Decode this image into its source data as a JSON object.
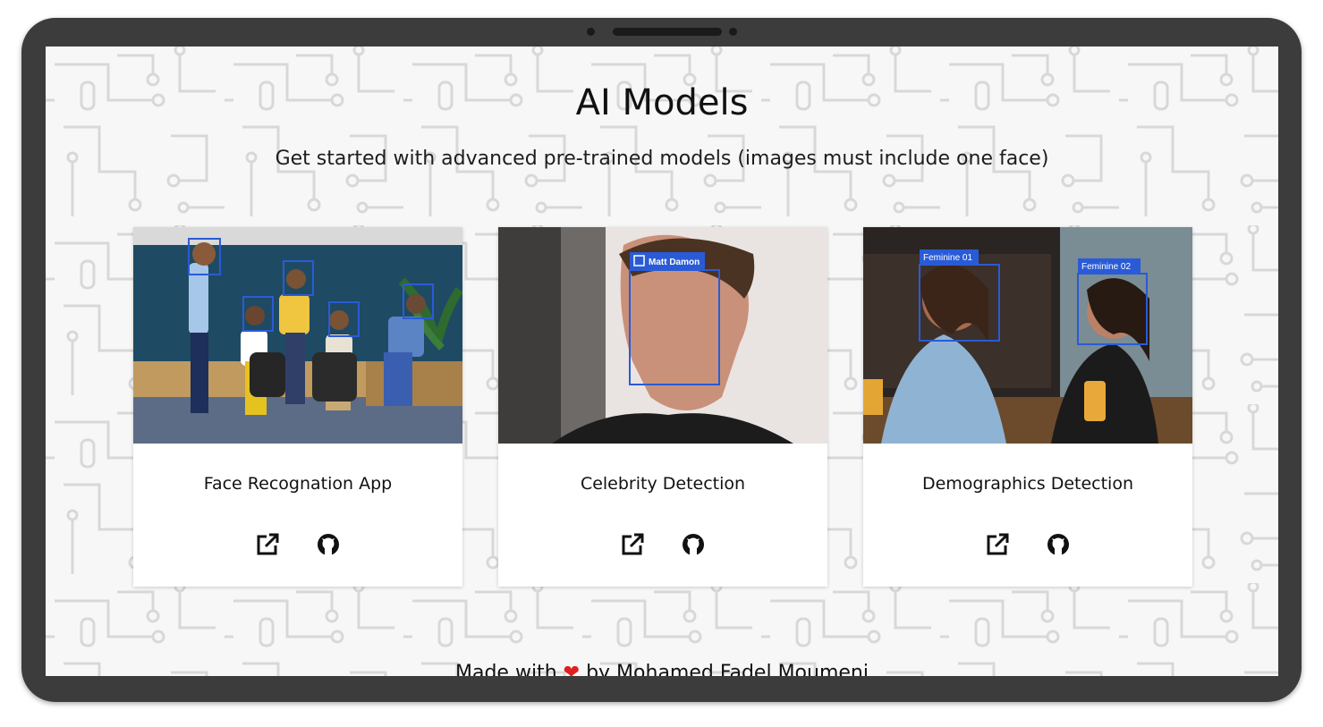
{
  "page": {
    "title": "AI Models",
    "subtitle": "Get started with advanced pre-trained models (images must include one face)"
  },
  "cards": [
    {
      "title": "Face Recognation App",
      "open_icon": "external-link-icon",
      "github_icon": "github-icon"
    },
    {
      "title": "Celebrity Detection",
      "face_label": "Matt Damon",
      "open_icon": "external-link-icon",
      "github_icon": "github-icon"
    },
    {
      "title": "Demographics Detection",
      "face_labels": [
        "Feminine 01",
        "Feminine 02"
      ],
      "open_icon": "external-link-icon",
      "github_icon": "github-icon"
    }
  ],
  "footer": {
    "prefix": "Made with",
    "heart": "❤",
    "suffix": "by Mohamed Fadel Moumeni"
  },
  "colors": {
    "detection_box": "#2a5bd7",
    "device_frame": "#3c3c3c",
    "heart": "#e02020"
  }
}
